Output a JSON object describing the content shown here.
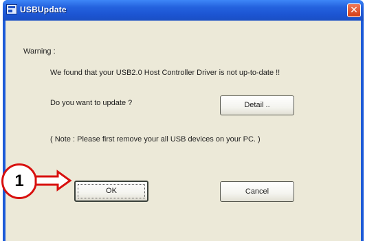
{
  "window": {
    "title": "USBUpdate",
    "close_label": "✕"
  },
  "dialog": {
    "warning_label": "Warning :",
    "message": "We found that your USB2.0 Host Controller Driver is not up-to-date !!",
    "question": "Do you want to update ?",
    "note": "( Note : Please first remove your all USB devices on your PC. )"
  },
  "buttons": {
    "detail": "Detail ..",
    "ok": "OK",
    "cancel": "Cancel"
  },
  "annotation": {
    "step_number": "1"
  },
  "colors": {
    "titlebar": "#2462de",
    "dialog_background": "#ece9d8",
    "annotation_red": "#d8100e"
  },
  "icons": [
    "app-icon",
    "close-icon",
    "arrow-right-icon"
  ]
}
